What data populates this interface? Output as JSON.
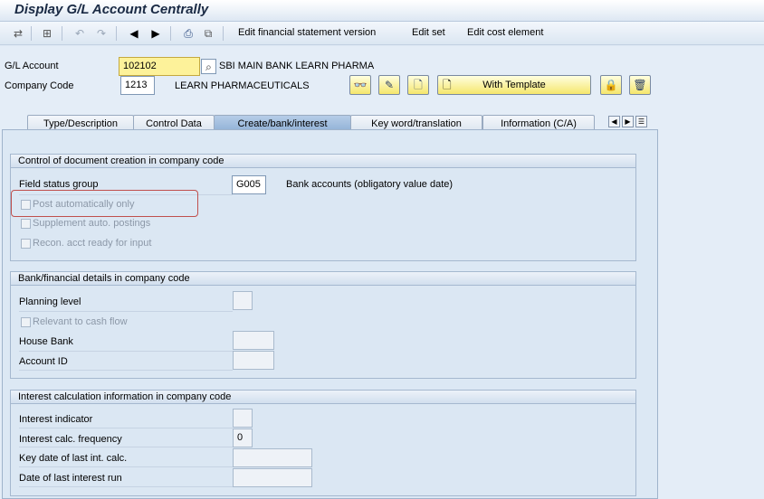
{
  "window": {
    "title": "Display G/L Account Centrally"
  },
  "toolbar": {
    "items": [
      "Edit financial statement version",
      "Edit set",
      "Edit cost element"
    ]
  },
  "header": {
    "gl_account_label": "G/L Account",
    "gl_account_value": "102102",
    "gl_account_desc": "SBI MAIN BANK LEARN PHARMA",
    "company_code_label": "Company Code",
    "company_code_value": "1213",
    "company_code_desc": "LEARN PHARMACEUTICALS",
    "with_template_label": "With Template"
  },
  "tabs": [
    {
      "label": "Type/Description"
    },
    {
      "label": "Control Data"
    },
    {
      "label": "Create/bank/interest"
    },
    {
      "label": "Key word/translation"
    },
    {
      "label": "Information (C/A)"
    }
  ],
  "group_doc": {
    "title": "Control of document creation in company code",
    "field_status_label": "Field status group",
    "field_status_value": "G005",
    "field_status_desc": "Bank accounts (obligatory value date)",
    "post_auto_label": "Post automatically only",
    "supplement_label": "Supplement auto. postings",
    "recon_label": "Recon. acct ready for input"
  },
  "group_bank": {
    "title": "Bank/financial details in company code",
    "planning_level_label": "Planning level",
    "cash_flow_label": "Relevant to cash flow",
    "house_bank_label": "House Bank",
    "account_id_label": "Account ID"
  },
  "group_interest": {
    "title": "Interest calculation information in company code",
    "indicator_label": "Interest indicator",
    "frequency_label": "Interest calc. frequency",
    "frequency_value": "0",
    "key_date_label": "Key date of last int. calc.",
    "last_run_label": "Date of last interest run"
  }
}
